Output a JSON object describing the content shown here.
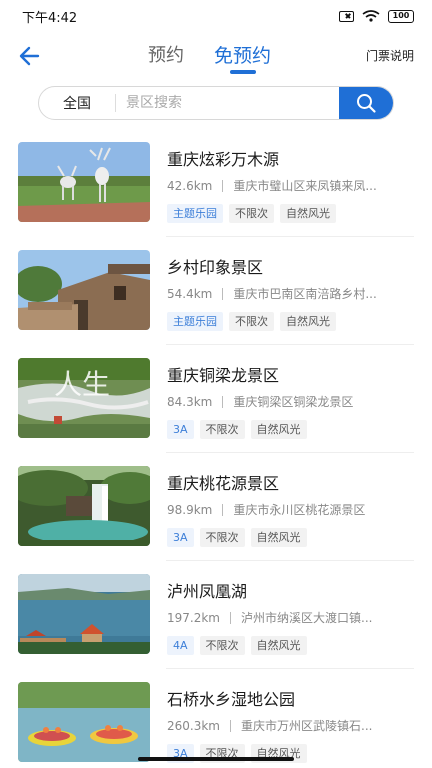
{
  "status_bar": {
    "time": "下午4:42",
    "battery": "100"
  },
  "header": {
    "tabs": [
      {
        "label": "预约",
        "active": false
      },
      {
        "label": "免预约",
        "active": true
      }
    ],
    "ticket_info": "门票说明"
  },
  "search": {
    "region": "全国",
    "placeholder": "景区搜索"
  },
  "colors": {
    "accent": "#1f6fd6",
    "tag_blue_bg": "#edf3fc",
    "tag_blue_text": "#3d7fd8"
  },
  "scenic_spots": [
    {
      "name": "重庆炫彩万木源",
      "distance": "42.6km",
      "address": "重庆市璧山区来凤镇来凤...",
      "tags": [
        "主题乐园",
        "不限次",
        "自然风光"
      ]
    },
    {
      "name": "乡村印象景区",
      "distance": "54.4km",
      "address": "重庆市巴南区南涪路乡村...",
      "tags": [
        "主题乐园",
        "不限次",
        "自然风光"
      ]
    },
    {
      "name": "重庆铜梁龙景区",
      "distance": "84.3km",
      "address": "重庆铜梁区铜梁龙景区",
      "tags": [
        "3A",
        "不限次",
        "自然风光"
      ],
      "overlay_text": "人生"
    },
    {
      "name": "重庆桃花源景区",
      "distance": "98.9km",
      "address": "重庆市永川区桃花源景区",
      "tags": [
        "3A",
        "不限次",
        "自然风光"
      ]
    },
    {
      "name": "泸州凤凰湖",
      "distance": "197.2km",
      "address": "泸州市纳溪区大渡口镇...",
      "tags": [
        "4A",
        "不限次",
        "自然风光"
      ]
    },
    {
      "name": "石桥水乡湿地公园",
      "distance": "260.3km",
      "address": "重庆市万州区武陵镇石...",
      "tags": [
        "3A",
        "不限次",
        "自然风光"
      ]
    }
  ]
}
